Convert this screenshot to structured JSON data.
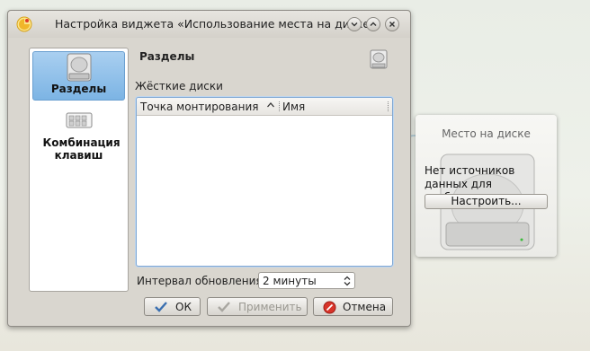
{
  "window": {
    "title": "Настройка виджета «Использование места на диске»",
    "buttons": {
      "minimize": "minimize",
      "maximize": "maximize",
      "close": "close"
    }
  },
  "sidebar": {
    "items": [
      {
        "label": "Разделы",
        "icon": "hard-drive-icon",
        "active": true
      },
      {
        "label": "Комбинация клавиш",
        "icon": "keyboard-icon",
        "active": false
      }
    ]
  },
  "page": {
    "title": "Разделы",
    "group_label": "Жёсткие диски",
    "columns": [
      "Точка монтирования",
      "Имя"
    ],
    "rows": [],
    "interval_label": "Интервал обновления:",
    "interval_value": "2 минуты"
  },
  "dialog_buttons": {
    "ok": "ОК",
    "apply": "Применить",
    "cancel": "Отмена"
  },
  "widget": {
    "title": "Место на диске",
    "message": "Нет источников данных для отображения",
    "configure_button": "Настроить..."
  },
  "colors": {
    "accent": "#7cb4e4",
    "window_bg": "#d9d6cf",
    "focus_border": "#7fa7d3"
  }
}
